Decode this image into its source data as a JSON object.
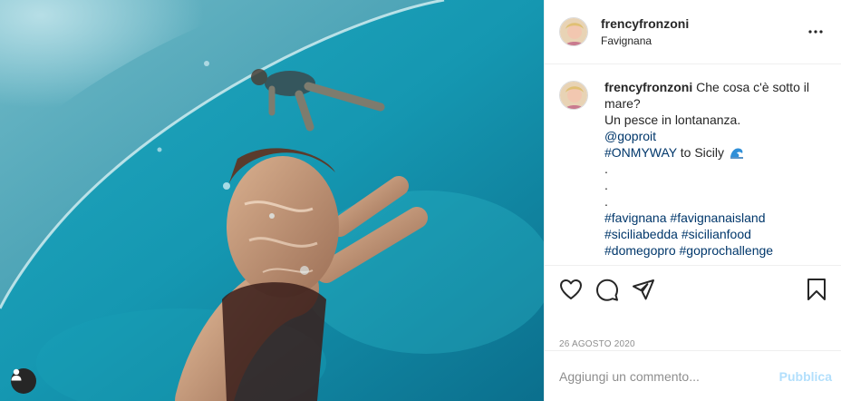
{
  "post": {
    "username": "frencyfronzoni",
    "location": "Favignana",
    "caption": {
      "username": "frencyfronzoni",
      "line1": "Che cosa c'è sotto il mare?",
      "line2": "Un pesce in lontananza.",
      "mention": "@goproit",
      "hashtag_onmyway": "#ONMYWAY",
      "to_sicily": " to Sicily",
      "dot1": ".",
      "dot2": ".",
      "dot3": ".",
      "tags1a": "#favignana",
      "tags1b": "#favignanaisland",
      "tags2a": "#siciliabedda",
      "tags2b": "#sicilianfood",
      "tags3a": "#domegopro",
      "tags3b": "#goprochallenge"
    },
    "date": "26 AGOSTO 2020"
  },
  "comment_box": {
    "placeholder": "Aggiungi un commento...",
    "post_label": "Pubblica"
  },
  "icons": {
    "more": "more-options-icon",
    "like": "heart-icon",
    "comment": "comment-bubble-icon",
    "share": "paper-plane-icon",
    "save": "bookmark-icon",
    "user_tag": "user-icon",
    "wave_emoji": "wave-emoji-icon"
  },
  "colors": {
    "link": "#00376b",
    "post_button_disabled": "#b2dffc",
    "secondary_text": "#8e8e8e",
    "divider": "#efefef"
  }
}
